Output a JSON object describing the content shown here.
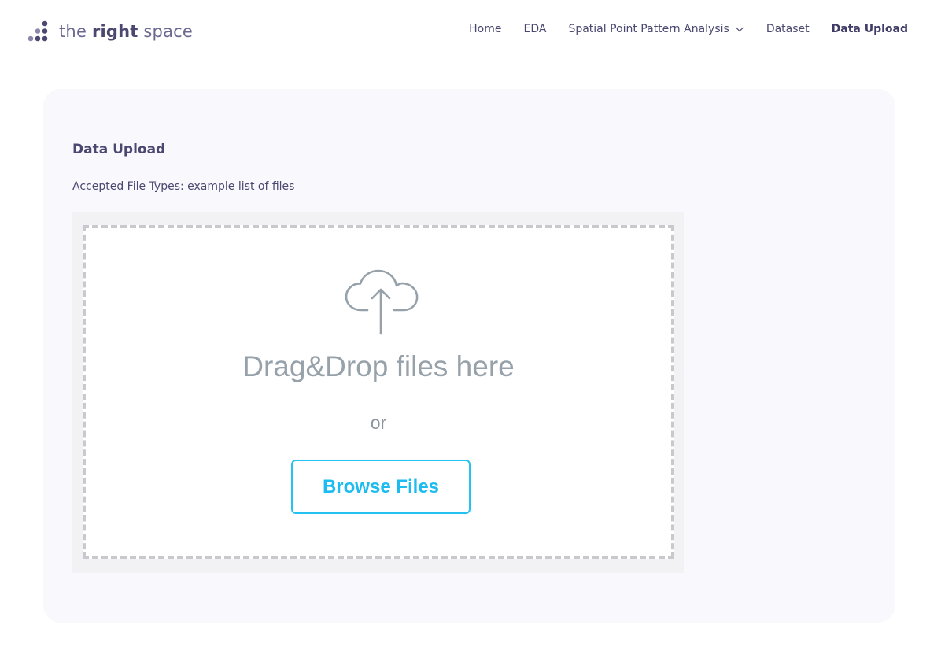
{
  "brand": {
    "logo_icon": "dots-logo-icon",
    "name_prefix": "the ",
    "name_strong": "right",
    "name_suffix": " space"
  },
  "nav": {
    "items": [
      {
        "label": "Home"
      },
      {
        "label": "EDA"
      },
      {
        "label": "Spatial Point Pattern Analysis",
        "icon": "chevron-down-icon"
      },
      {
        "label": "Dataset"
      },
      {
        "label": "Data Upload",
        "active": true
      }
    ]
  },
  "upload": {
    "title": "Data Upload",
    "accepted_types": "Accepted File Types: example list of files",
    "dropzone": {
      "icon": "cloud-upload-icon",
      "headline": "Drag&Drop files here",
      "separator": "or",
      "browse_label": "Browse Files"
    }
  },
  "colors": {
    "brand_text": "#4a4770",
    "card_bg": "#f8f8fd",
    "dropzone_border": "#c9c9cd",
    "accent": "#1dbcf0",
    "muted_text": "#96a1aa"
  }
}
